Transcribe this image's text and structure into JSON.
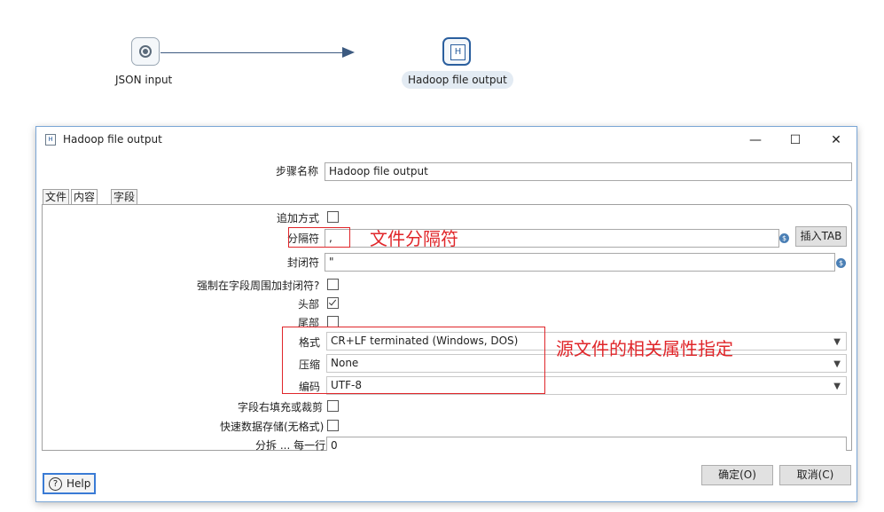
{
  "canvas": {
    "nodes": [
      {
        "label": "JSON input"
      },
      {
        "label": "Hadoop file output"
      }
    ]
  },
  "dialog": {
    "title": "Hadoop file output",
    "controls": {
      "minimize": "—",
      "maximize": "☐",
      "close": "✕"
    },
    "step_name_label": "步骤名称",
    "step_name_value": "Hadoop file output",
    "tabs": [
      "文件",
      "内容",
      "字段"
    ],
    "active_tab": "内容",
    "form": {
      "append_label": "追加方式",
      "append_checked": false,
      "separator_label": "分隔符",
      "separator_value": ",",
      "insert_tab_label": "插入TAB",
      "enclosure_label": "封闭符",
      "enclosure_value": "\"",
      "force_enclosure_label": "强制在字段周围加封闭符?",
      "force_enclosure_checked": false,
      "header_label": "头部",
      "header_checked": true,
      "footer_label": "尾部",
      "footer_checked": false,
      "format_label": "格式",
      "format_value": "CR+LF terminated (Windows, DOS)",
      "compression_label": "压缩",
      "compression_value": "None",
      "encoding_label": "编码",
      "encoding_value": "UTF-8",
      "pad_label": "字段右填充或裁剪",
      "pad_checked": false,
      "fast_dump_label": "快速数据存储(无格式)",
      "fast_dump_checked": false,
      "split_label": "分拆 ... 每一行",
      "split_value": "0"
    },
    "buttons": {
      "ok": "确定(O)",
      "cancel": "取消(C)",
      "help": "Help"
    }
  },
  "annotations": {
    "separator_note": "文件分隔符",
    "source_props_note": "源文件的相关属性指定"
  },
  "colors": {
    "annotation": "#e0262a",
    "hop": "#3c5a80",
    "selected_node_border": "#2b5f9e"
  },
  "icons": {
    "json_node": "json-input-icon",
    "hadoop_node": "hadoop-output-icon",
    "variable": "variable-dollar-icon",
    "help": "question-icon"
  }
}
